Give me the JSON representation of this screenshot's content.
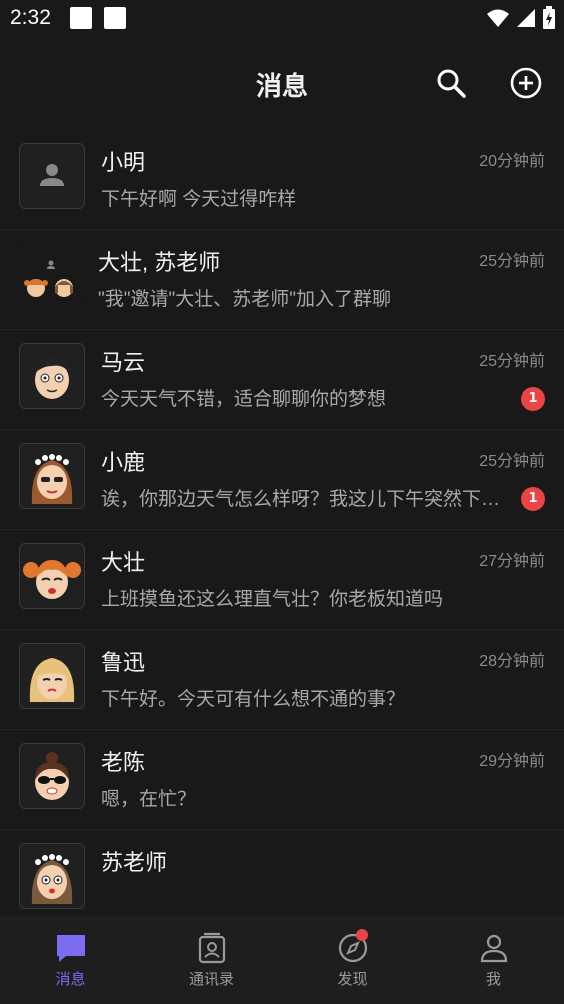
{
  "status_bar": {
    "time": "2:32"
  },
  "header": {
    "title": "消息"
  },
  "conversations": [
    {
      "name": "小明",
      "preview": "下午好啊 今天过得咋样",
      "time": "20分钟前",
      "badge": "",
      "avatar": "default-person-icon"
    },
    {
      "name": "大壮, 苏老师",
      "preview": "\"我\"邀请\"大壮、苏老师\"加入了群聊",
      "time": "25分钟前",
      "badge": "",
      "avatar": "group-avatar"
    },
    {
      "name": "马云",
      "preview": "今天天气不错，适合聊聊你的梦想",
      "time": "25分钟前",
      "badge": "1",
      "avatar": "cartoon-man-avatar"
    },
    {
      "name": "小鹿",
      "preview": "诶，你那边天气怎么样呀？我这儿下午突然下起了大雨",
      "time": "25分钟前",
      "badge": "1",
      "avatar": "cartoon-girl-flower-avatar"
    },
    {
      "name": "大壮",
      "preview": "上班摸鱼还这么理直气壮？你老板知道吗",
      "time": "27分钟前",
      "badge": "",
      "avatar": "cartoon-pigtails-avatar"
    },
    {
      "name": "鲁迅",
      "preview": "下午好。今天可有什么想不通的事？",
      "time": "28分钟前",
      "badge": "",
      "avatar": "cartoon-blonde-avatar"
    },
    {
      "name": "老陈",
      "preview": "嗯，在忙？",
      "time": "29分钟前",
      "badge": "",
      "avatar": "cartoon-sunglasses-avatar"
    },
    {
      "name": "苏老师",
      "preview": "",
      "time": "",
      "badge": "",
      "avatar": "cartoon-teacher-avatar"
    }
  ],
  "tabs": [
    {
      "label": "消息",
      "icon": "chat-icon",
      "active": true
    },
    {
      "label": "通讯录",
      "icon": "contacts-icon",
      "active": false
    },
    {
      "label": "发现",
      "icon": "compass-icon",
      "active": false
    },
    {
      "label": "我",
      "icon": "profile-icon",
      "active": false
    }
  ],
  "colors": {
    "accent": "#7b6cf0",
    "badge": "#e94545",
    "background": "#191919"
  }
}
